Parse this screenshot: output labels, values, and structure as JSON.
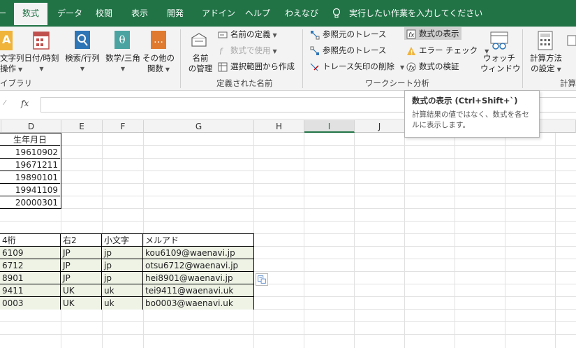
{
  "tabs": [
    {
      "label": "数式",
      "active": true
    },
    {
      "label": "データ"
    },
    {
      "label": "校閲"
    },
    {
      "label": "表示"
    },
    {
      "label": "開発"
    },
    {
      "label": "アドイン"
    },
    {
      "label": "ヘルプ"
    },
    {
      "label": "わえなび"
    }
  ],
  "tellme": "実行したい作業を入力してください",
  "ribbon": {
    "func_lib": {
      "text_l1": "文字列",
      "text_l2": "操作",
      "date_l1": "日付/時刻",
      "lookup_l1": "検索/行列",
      "math_l1": "数学/三角",
      "other_l1": "その他の",
      "other_l2": "関数",
      "group": "イブラリ"
    },
    "names": {
      "manager_l1": "名前",
      "manager_l2": "の管理",
      "define": "名前の定義",
      "use": "数式で使用",
      "create": "選択範囲から作成",
      "group": "定義された名前"
    },
    "audit": {
      "precedents": "参照元のトレース",
      "dependents": "参照先のトレース",
      "remove": "トレース矢印の削除",
      "show_formulas": "数式の表示",
      "error_check": "エラー チェック",
      "evaluate": "数式の検証",
      "watch_l1": "ウォッチ",
      "watch_l2": "ウィンドウ",
      "group": "ワークシート分析"
    },
    "calc": {
      "options_l1": "計算方法",
      "options_l2": "の設定",
      "group": "計算"
    }
  },
  "formula_bar": {
    "fx": "fx",
    "value": ""
  },
  "tooltip": {
    "title": "数式の表示 (Ctrl+Shift+`)",
    "body": "計算結果の値ではなく、数式を各セルに表示します。"
  },
  "columns": [
    "D",
    "E",
    "F",
    "G",
    "H",
    "I",
    "J"
  ],
  "selected_column": "I",
  "table1": {
    "header": "生年月日",
    "values": [
      "19610902",
      "19671211",
      "19890101",
      "19941109",
      "20000301"
    ]
  },
  "table2": {
    "headers": [
      "4桁",
      "右2",
      "小文字",
      "メルアド"
    ],
    "rows": [
      [
        "6109",
        "JP",
        "jp",
        "kou6109@waenavi.jp"
      ],
      [
        "6712",
        "JP",
        "jp",
        "otsu6712@waenavi.jp"
      ],
      [
        "8901",
        "JP",
        "jp",
        "hei8901@waenavi.jp"
      ],
      [
        "9411",
        "UK",
        "uk",
        "tei9411@waenavi.uk"
      ],
      [
        "0003",
        "UK",
        "uk",
        "bo0003@waenavi.uk"
      ]
    ]
  },
  "colors": {
    "brand": "#217346",
    "cell_fill": "#eef3e6"
  }
}
